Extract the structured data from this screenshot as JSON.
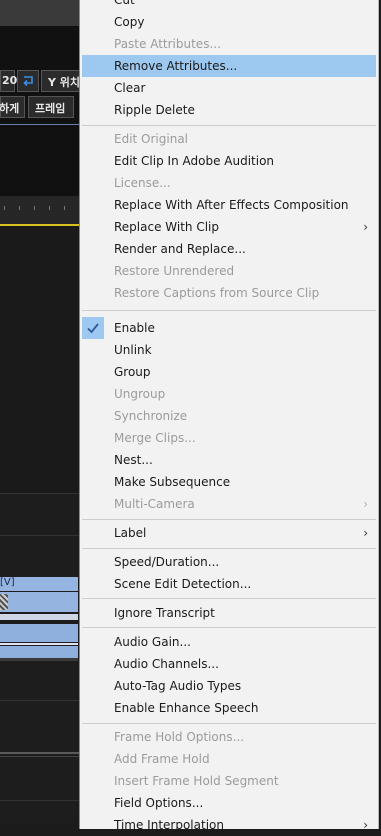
{
  "background_app": {
    "timecode_fragment": "20",
    "y_position_label": "Y 위치",
    "btn_label_1": "하게",
    "btn_label_2": "프레임",
    "clip_label": "[V]"
  },
  "menu": {
    "items": [
      {
        "label": "Cut",
        "enabled": true
      },
      {
        "label": "Copy",
        "enabled": true
      },
      {
        "label": "Paste Attributes...",
        "enabled": false
      },
      {
        "label": "Remove Attributes...",
        "enabled": true,
        "highlighted": true
      },
      {
        "label": "Clear",
        "enabled": true
      },
      {
        "label": "Ripple Delete",
        "enabled": true
      },
      {
        "label": "Edit Original",
        "enabled": false
      },
      {
        "label": "Edit Clip In Adobe Audition",
        "enabled": true
      },
      {
        "label": "License...",
        "enabled": false
      },
      {
        "label": "Replace With After Effects Composition",
        "enabled": true
      },
      {
        "label": "Replace With Clip",
        "enabled": true,
        "submenu": true
      },
      {
        "label": "Render and Replace...",
        "enabled": true
      },
      {
        "label": "Restore Unrendered",
        "enabled": false
      },
      {
        "label": "Restore Captions from Source Clip",
        "enabled": false
      },
      {
        "label": "Enable",
        "enabled": true,
        "checked": true
      },
      {
        "label": "Unlink",
        "enabled": true
      },
      {
        "label": "Group",
        "enabled": true
      },
      {
        "label": "Ungroup",
        "enabled": false
      },
      {
        "label": "Synchronize",
        "enabled": false
      },
      {
        "label": "Merge Clips...",
        "enabled": false
      },
      {
        "label": "Nest...",
        "enabled": true
      },
      {
        "label": "Make Subsequence",
        "enabled": true
      },
      {
        "label": "Multi-Camera",
        "enabled": false,
        "submenu": true
      },
      {
        "label": "Label",
        "enabled": true,
        "submenu": true
      },
      {
        "label": "Speed/Duration...",
        "enabled": true
      },
      {
        "label": "Scene Edit Detection...",
        "enabled": true
      },
      {
        "label": "Ignore Transcript",
        "enabled": true
      },
      {
        "label": "Audio Gain...",
        "enabled": true
      },
      {
        "label": "Audio Channels...",
        "enabled": true
      },
      {
        "label": "Auto-Tag Audio Types",
        "enabled": true
      },
      {
        "label": "Enable Enhance Speech",
        "enabled": true
      },
      {
        "label": "Frame Hold Options...",
        "enabled": false
      },
      {
        "label": "Add Frame Hold",
        "enabled": false
      },
      {
        "label": "Insert Frame Hold Segment",
        "enabled": false
      },
      {
        "label": "Field Options...",
        "enabled": true
      },
      {
        "label": "Time Interpolation",
        "enabled": true,
        "submenu": true
      }
    ],
    "colors": {
      "background": "#f2f2f2",
      "highlight": "#9dc8ef",
      "text": "#1a1a1a",
      "disabled_text": "#9b9b9b",
      "separator": "#cdcdcd"
    }
  }
}
